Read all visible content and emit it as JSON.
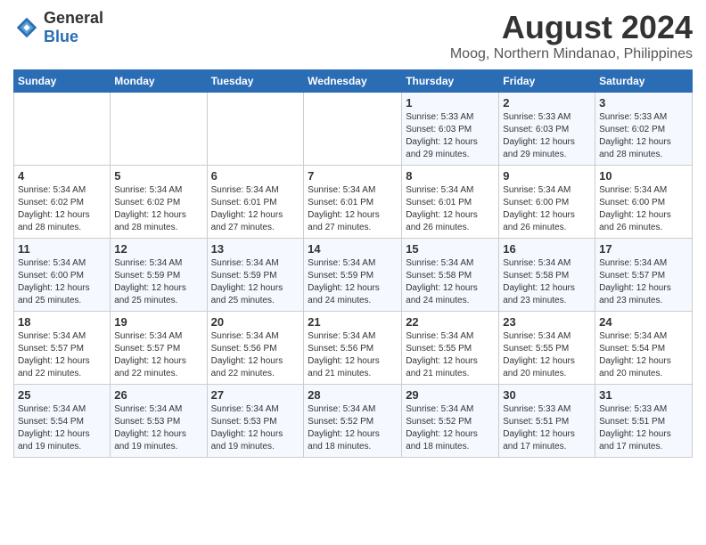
{
  "header": {
    "logo_general": "General",
    "logo_blue": "Blue",
    "month_year": "August 2024",
    "location": "Moog, Northern Mindanao, Philippines"
  },
  "days_of_week": [
    "Sunday",
    "Monday",
    "Tuesday",
    "Wednesday",
    "Thursday",
    "Friday",
    "Saturday"
  ],
  "weeks": [
    [
      {
        "day": "",
        "info": ""
      },
      {
        "day": "",
        "info": ""
      },
      {
        "day": "",
        "info": ""
      },
      {
        "day": "",
        "info": ""
      },
      {
        "day": "1",
        "info": "Sunrise: 5:33 AM\nSunset: 6:03 PM\nDaylight: 12 hours\nand 29 minutes."
      },
      {
        "day": "2",
        "info": "Sunrise: 5:33 AM\nSunset: 6:03 PM\nDaylight: 12 hours\nand 29 minutes."
      },
      {
        "day": "3",
        "info": "Sunrise: 5:33 AM\nSunset: 6:02 PM\nDaylight: 12 hours\nand 28 minutes."
      }
    ],
    [
      {
        "day": "4",
        "info": "Sunrise: 5:34 AM\nSunset: 6:02 PM\nDaylight: 12 hours\nand 28 minutes."
      },
      {
        "day": "5",
        "info": "Sunrise: 5:34 AM\nSunset: 6:02 PM\nDaylight: 12 hours\nand 28 minutes."
      },
      {
        "day": "6",
        "info": "Sunrise: 5:34 AM\nSunset: 6:01 PM\nDaylight: 12 hours\nand 27 minutes."
      },
      {
        "day": "7",
        "info": "Sunrise: 5:34 AM\nSunset: 6:01 PM\nDaylight: 12 hours\nand 27 minutes."
      },
      {
        "day": "8",
        "info": "Sunrise: 5:34 AM\nSunset: 6:01 PM\nDaylight: 12 hours\nand 26 minutes."
      },
      {
        "day": "9",
        "info": "Sunrise: 5:34 AM\nSunset: 6:00 PM\nDaylight: 12 hours\nand 26 minutes."
      },
      {
        "day": "10",
        "info": "Sunrise: 5:34 AM\nSunset: 6:00 PM\nDaylight: 12 hours\nand 26 minutes."
      }
    ],
    [
      {
        "day": "11",
        "info": "Sunrise: 5:34 AM\nSunset: 6:00 PM\nDaylight: 12 hours\nand 25 minutes."
      },
      {
        "day": "12",
        "info": "Sunrise: 5:34 AM\nSunset: 5:59 PM\nDaylight: 12 hours\nand 25 minutes."
      },
      {
        "day": "13",
        "info": "Sunrise: 5:34 AM\nSunset: 5:59 PM\nDaylight: 12 hours\nand 25 minutes."
      },
      {
        "day": "14",
        "info": "Sunrise: 5:34 AM\nSunset: 5:59 PM\nDaylight: 12 hours\nand 24 minutes."
      },
      {
        "day": "15",
        "info": "Sunrise: 5:34 AM\nSunset: 5:58 PM\nDaylight: 12 hours\nand 24 minutes."
      },
      {
        "day": "16",
        "info": "Sunrise: 5:34 AM\nSunset: 5:58 PM\nDaylight: 12 hours\nand 23 minutes."
      },
      {
        "day": "17",
        "info": "Sunrise: 5:34 AM\nSunset: 5:57 PM\nDaylight: 12 hours\nand 23 minutes."
      }
    ],
    [
      {
        "day": "18",
        "info": "Sunrise: 5:34 AM\nSunset: 5:57 PM\nDaylight: 12 hours\nand 22 minutes."
      },
      {
        "day": "19",
        "info": "Sunrise: 5:34 AM\nSunset: 5:57 PM\nDaylight: 12 hours\nand 22 minutes."
      },
      {
        "day": "20",
        "info": "Sunrise: 5:34 AM\nSunset: 5:56 PM\nDaylight: 12 hours\nand 22 minutes."
      },
      {
        "day": "21",
        "info": "Sunrise: 5:34 AM\nSunset: 5:56 PM\nDaylight: 12 hours\nand 21 minutes."
      },
      {
        "day": "22",
        "info": "Sunrise: 5:34 AM\nSunset: 5:55 PM\nDaylight: 12 hours\nand 21 minutes."
      },
      {
        "day": "23",
        "info": "Sunrise: 5:34 AM\nSunset: 5:55 PM\nDaylight: 12 hours\nand 20 minutes."
      },
      {
        "day": "24",
        "info": "Sunrise: 5:34 AM\nSunset: 5:54 PM\nDaylight: 12 hours\nand 20 minutes."
      }
    ],
    [
      {
        "day": "25",
        "info": "Sunrise: 5:34 AM\nSunset: 5:54 PM\nDaylight: 12 hours\nand 19 minutes."
      },
      {
        "day": "26",
        "info": "Sunrise: 5:34 AM\nSunset: 5:53 PM\nDaylight: 12 hours\nand 19 minutes."
      },
      {
        "day": "27",
        "info": "Sunrise: 5:34 AM\nSunset: 5:53 PM\nDaylight: 12 hours\nand 19 minutes."
      },
      {
        "day": "28",
        "info": "Sunrise: 5:34 AM\nSunset: 5:52 PM\nDaylight: 12 hours\nand 18 minutes."
      },
      {
        "day": "29",
        "info": "Sunrise: 5:34 AM\nSunset: 5:52 PM\nDaylight: 12 hours\nand 18 minutes."
      },
      {
        "day": "30",
        "info": "Sunrise: 5:33 AM\nSunset: 5:51 PM\nDaylight: 12 hours\nand 17 minutes."
      },
      {
        "day": "31",
        "info": "Sunrise: 5:33 AM\nSunset: 5:51 PM\nDaylight: 12 hours\nand 17 minutes."
      }
    ]
  ]
}
